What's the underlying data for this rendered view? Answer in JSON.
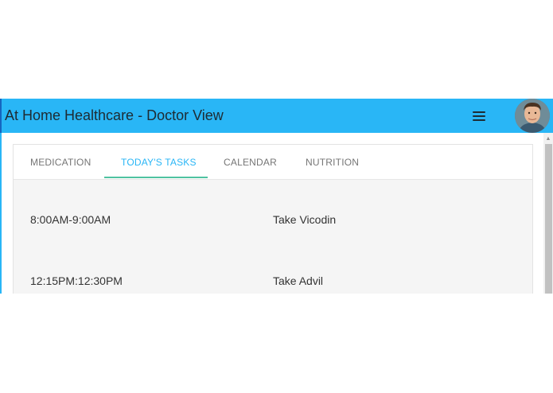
{
  "header": {
    "title": "At Home Healthcare - Doctor View",
    "menu_icon": "hamburger-menu-icon",
    "avatar_icon": "user-avatar"
  },
  "tabs": [
    {
      "label": "MEDICATION",
      "active": false
    },
    {
      "label": "TODAY'S TASKS",
      "active": true
    },
    {
      "label": "CALENDAR",
      "active": false
    },
    {
      "label": "NUTRITION",
      "active": false
    }
  ],
  "tasks": [
    {
      "time": "8:00AM-9:00AM",
      "description": "Take Vicodin"
    },
    {
      "time": "12:15PM:12:30PM",
      "description": "Take Advil"
    }
  ],
  "colors": {
    "header_bg": "#29b6f6",
    "active_tab": "#29b6f6",
    "tab_indicator": "#4fc3a1",
    "card_bg": "#f5f5f5"
  }
}
